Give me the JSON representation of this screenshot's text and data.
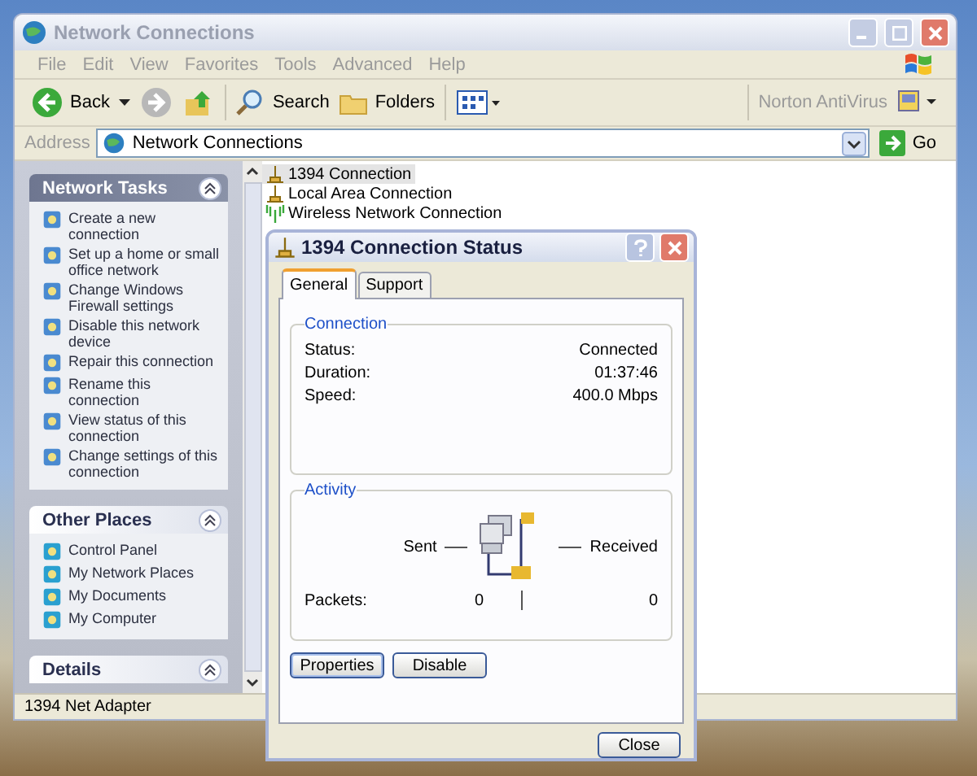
{
  "window": {
    "title": "Network Connections"
  },
  "menu": [
    "File",
    "Edit",
    "View",
    "Favorites",
    "Tools",
    "Advanced",
    "Help"
  ],
  "toolbar": {
    "back": "Back",
    "search": "Search",
    "folders": "Folders",
    "norton": "Norton AntiVirus"
  },
  "address": {
    "label": "Address",
    "value": "Network Connections",
    "go": "Go"
  },
  "sidebar": [
    {
      "kind": "special",
      "title": "Network Tasks",
      "items": [
        "Create a new connection",
        "Set up a home or small office network",
        "Change Windows Firewall settings",
        "Disable this network device",
        "Repair this connection",
        "Rename this connection",
        "View status of this connection",
        "Change settings of this connection"
      ]
    },
    {
      "kind": "normal",
      "title": "Other Places",
      "items": [
        "Control Panel",
        "My Network Places",
        "My Documents",
        "My Computer"
      ]
    },
    {
      "kind": "normal",
      "title": "Details"
    }
  ],
  "connections": [
    {
      "kind": "wired",
      "label": "1394 Connection",
      "selected": true
    },
    {
      "kind": "wired",
      "label": "Local Area Connection",
      "selected": false
    },
    {
      "kind": "wireless",
      "label": "Wireless Network Connection",
      "selected": false
    }
  ],
  "status_bar": "1394 Net Adapter",
  "dialog": {
    "title": "1394 Connection Status",
    "tabs": [
      {
        "label": "General",
        "selected": true
      },
      {
        "label": "Support",
        "selected": false
      }
    ],
    "connection": {
      "title": "Connection",
      "rows": [
        {
          "label": "Status:",
          "value": "Connected"
        },
        {
          "label": "Duration:",
          "value": "01:37:46"
        },
        {
          "label": "Speed:",
          "value": "400.0 Mbps"
        }
      ]
    },
    "activity": {
      "title": "Activity",
      "sent": "Sent",
      "received": "Received",
      "packets_label": "Packets:",
      "sent_value": "0",
      "received_value": "0"
    },
    "buttons": [
      "Properties",
      "Disable"
    ],
    "close": "Close"
  }
}
